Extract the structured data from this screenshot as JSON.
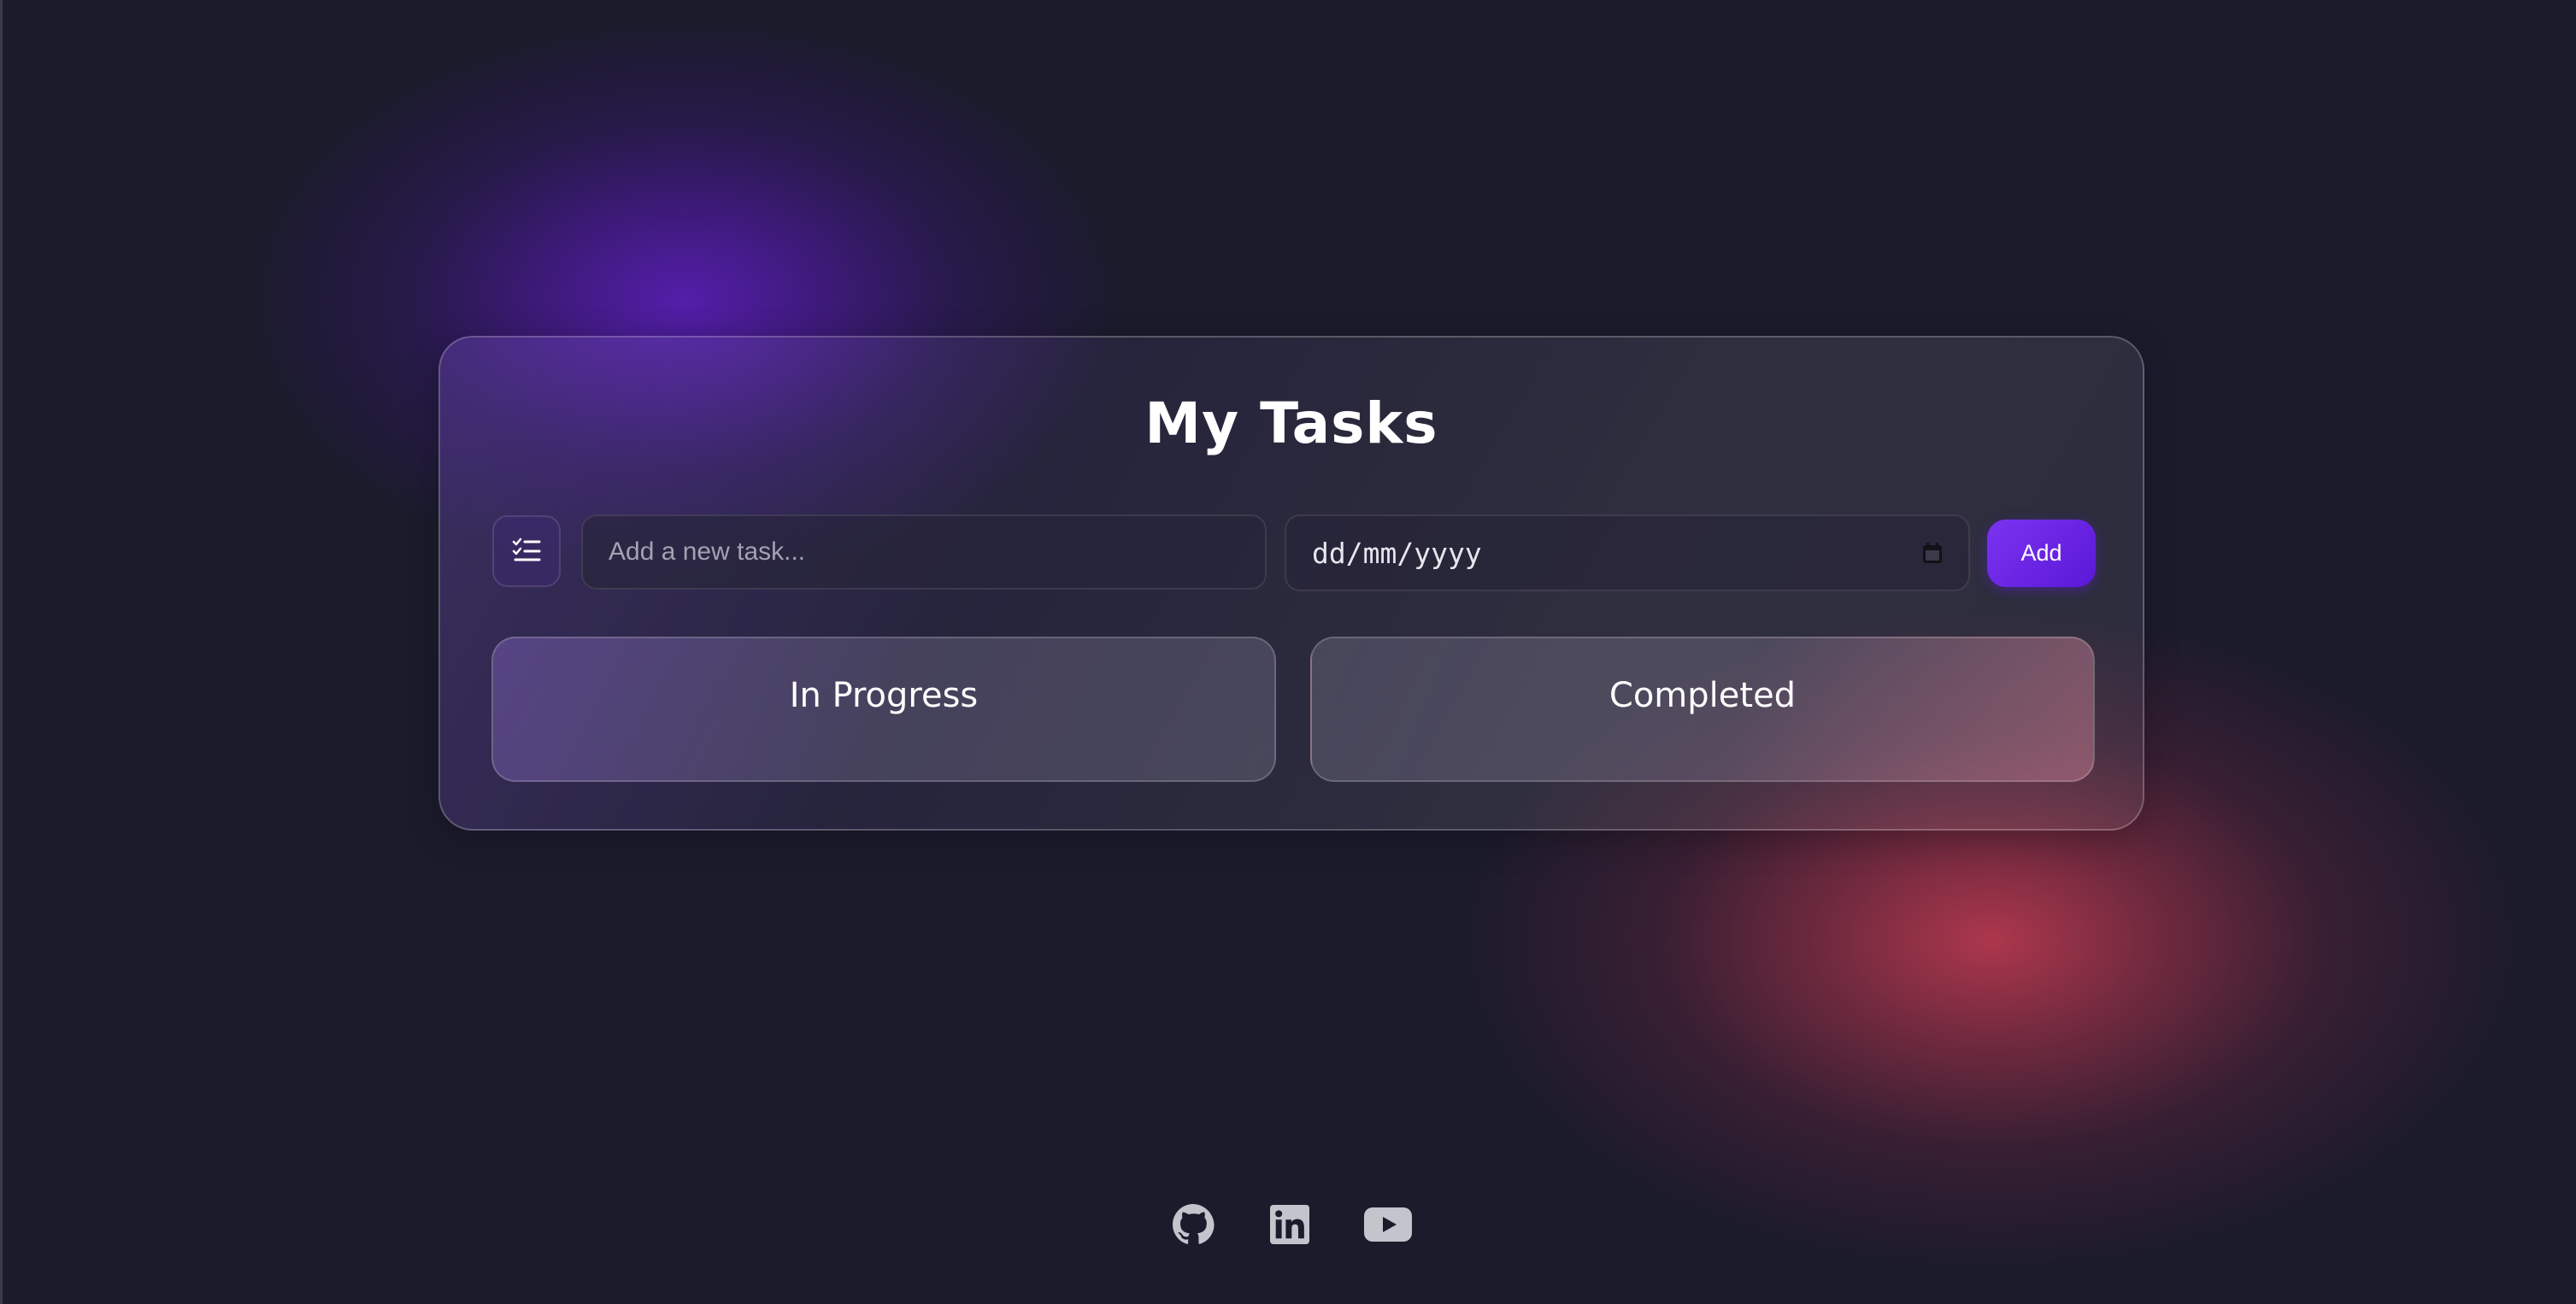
{
  "colors": {
    "background": "#1b1b2c",
    "accent": "#6a22e4",
    "glow_purple": "#561eb0",
    "glow_red": "#b4384e",
    "icon_gray": "#c4c4cc"
  },
  "card": {
    "title": "My Tasks",
    "list_icon": "checklist-icon",
    "task_input": {
      "value": "",
      "placeholder": "Add a new task..."
    },
    "date_input": {
      "value": "dd/mm/yyyy",
      "icon": "calendar-icon"
    },
    "add_button_label": "Add",
    "columns": [
      {
        "title": "In Progress"
      },
      {
        "title": "Completed"
      }
    ]
  },
  "footer": {
    "social_icons": [
      "github-icon",
      "linkedin-icon",
      "youtube-icon"
    ]
  }
}
